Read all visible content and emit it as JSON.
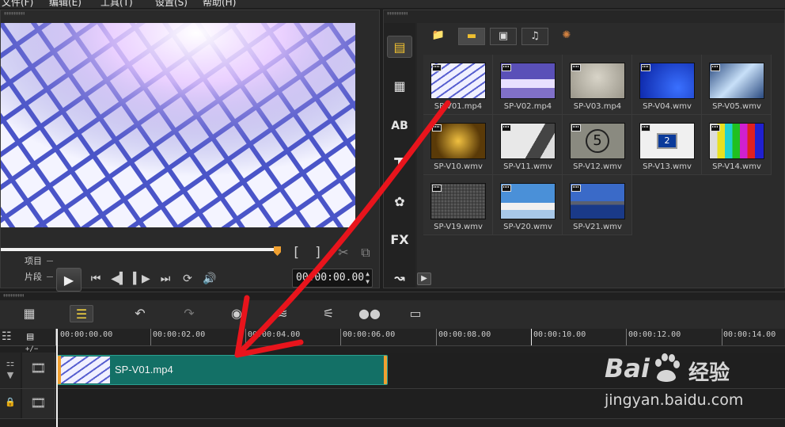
{
  "menubar": {
    "items": [
      "文件(F)",
      "编辑(E)",
      "工具(T)",
      "设置(S)",
      "帮助(H)"
    ]
  },
  "preview": {
    "mode_project": "项目",
    "mode_clip": "片段",
    "timecode": "00:00:00.00",
    "bracket_in": "[",
    "bracket_out": "]"
  },
  "library": {
    "side_items": [
      "media-icon",
      "transition-icon",
      "title-icon",
      "text-icon",
      "graphic-icon",
      "filter-icon",
      "path-icon"
    ],
    "side_labels": {
      "title": "AB",
      "text": "T",
      "filter": "FX"
    },
    "tiles": [
      {
        "label": "SP-V01.mp4"
      },
      {
        "label": "SP-V02.mp4"
      },
      {
        "label": "SP-V03.mp4"
      },
      {
        "label": "SP-V04.wmv"
      },
      {
        "label": "SP-V05.wmv"
      },
      {
        "label": "SP-V10.wmv"
      },
      {
        "label": "SP-V11.wmv"
      },
      {
        "label": "SP-V12.wmv"
      },
      {
        "label": "SP-V13.wmv"
      },
      {
        "label": "SP-V14.wmv"
      },
      {
        "label": "SP-V19.wmv"
      },
      {
        "label": "SP-V20.wmv"
      },
      {
        "label": "SP-V21.wmv"
      }
    ]
  },
  "timeline": {
    "ruler": [
      "00:00:00.00",
      "00:00:02.00",
      "00:00:04.00",
      "00:00:06.00",
      "00:00:08.00",
      "00:00:10.00",
      "00:00:12.00",
      "00:00:14.00"
    ],
    "clip_label": "SP-V01.mp4",
    "track_add": "+/−"
  },
  "watermark": {
    "brand_a": "Bai",
    "brand_b": "经验",
    "url": "jingyan.baidu.com"
  },
  "colors": {
    "accent": "#f0a030",
    "clip": "#137066",
    "annotation": "#e8141c"
  }
}
